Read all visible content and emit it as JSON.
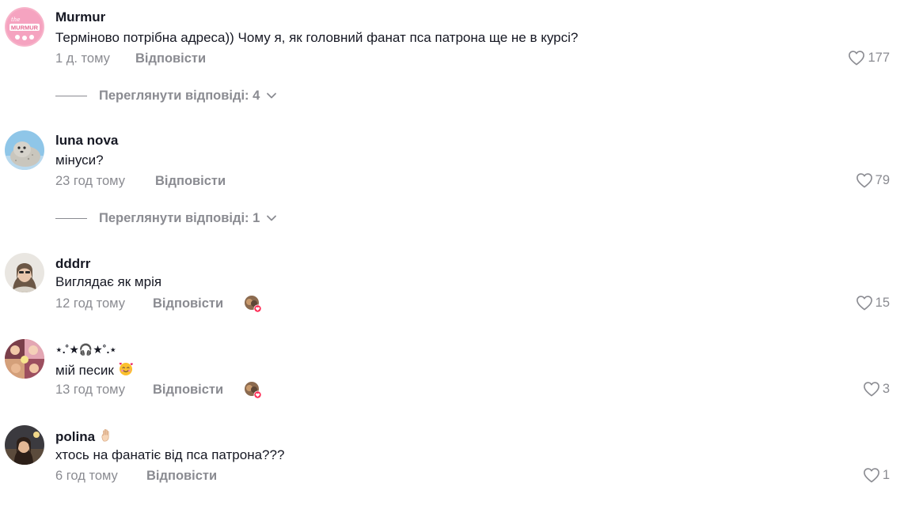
{
  "reply_label": "Відповісти",
  "comments": [
    {
      "username": "Murmur",
      "text": "Терміново потрібна адреса)) Чому я, як головний фанат пса патрона ще не в курсі?",
      "time": "1 д. тому",
      "likes": "177",
      "avatar_text": "MURMUR",
      "view_replies": "Переглянути відповіді: 4",
      "creator_liked": false
    },
    {
      "username": "luna nova",
      "text": "мінуси?",
      "time": "23 год тому",
      "likes": "79",
      "view_replies": "Переглянути відповіді: 1",
      "creator_liked": false
    },
    {
      "username": "dddrr",
      "text": "Виглядає як мрія",
      "time": "12 год тому",
      "likes": "15",
      "creator_liked": true
    },
    {
      "username": "⋆.˚★🎧★˚.⋆",
      "text": "мій песик",
      "time": "13 год тому",
      "likes": "3",
      "creator_liked": true
    },
    {
      "username": "polina",
      "text": "хтось на фанатіє від пса патрона???",
      "time": "6 год тому",
      "likes": "1",
      "creator_liked": false
    }
  ],
  "colors": {
    "primary_text": "#161823",
    "secondary_text": "#8a8b91",
    "like_badge": "#fe2c55",
    "murmur_pink": "#f5a3c0"
  }
}
